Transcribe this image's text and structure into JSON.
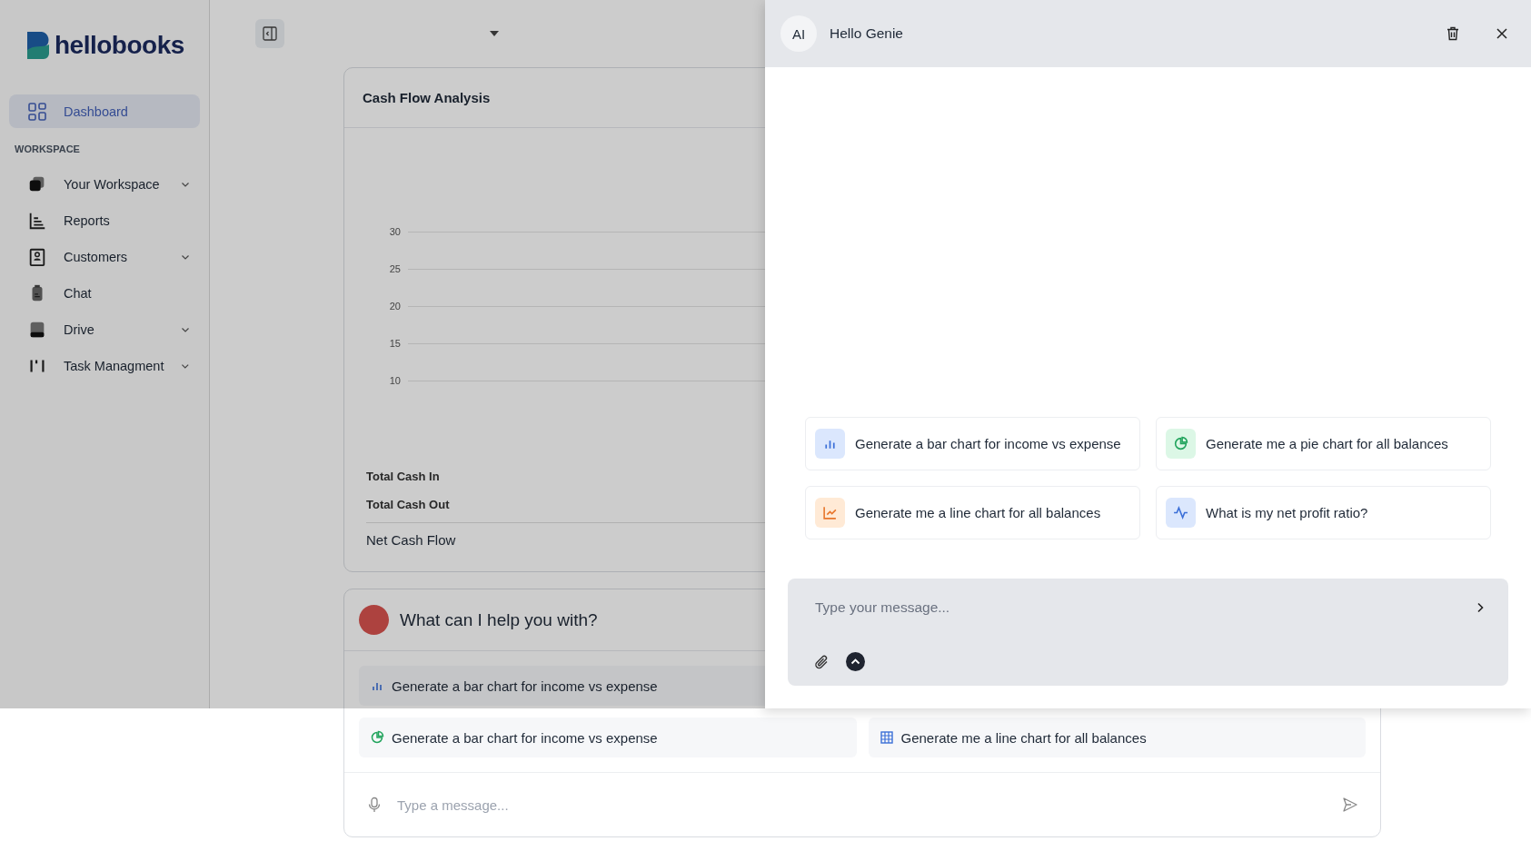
{
  "logo": {
    "text": "hellobooks"
  },
  "sidebar": {
    "top_items": [
      {
        "label": "Dashboard",
        "selected": true
      }
    ],
    "section_title": "WORKSPACE",
    "items": [
      {
        "label": "Your Workspace",
        "selected": false,
        "has_submenu": true
      },
      {
        "label": "Reports",
        "selected": false,
        "has_submenu": false
      },
      {
        "label": "Customers",
        "selected": false,
        "has_submenu": true
      },
      {
        "label": "Chat",
        "selected": false,
        "has_submenu": false
      },
      {
        "label": "Drive",
        "selected": false,
        "has_submenu": true
      },
      {
        "label": "Task Managment",
        "selected": false,
        "has_submenu": true
      }
    ]
  },
  "cash_flow_card": {
    "title": "Cash Flow Analysis",
    "y_axis_labels": [
      "30",
      "25",
      "20",
      "15",
      "10"
    ],
    "totals": [
      "Total Cash In",
      "Total Cash Out"
    ],
    "net_label": "Net Cash Flow"
  },
  "assistant_card": {
    "title": "What can I help you with?",
    "suggestion_rows": [
      [
        {
          "text": "Generate a bar chart for income vs expense",
          "kind": "bar"
        }
      ],
      [
        {
          "text": "Generate a bar chart for income vs expense",
          "kind": "pie"
        },
        {
          "text": "Generate me a line chart for all balances",
          "kind": "table"
        }
      ]
    ],
    "input": {
      "placeholder": "Type a message..."
    }
  },
  "chat_panel": {
    "avatar": "AI",
    "title": "Hello Genie",
    "suggestions": [
      {
        "text": "Generate a bar chart for income vs expense",
        "kind": "bar"
      },
      {
        "text": "Generate me a pie chart for all balances",
        "kind": "pie"
      },
      {
        "text": "Generate me a line chart for all balances",
        "kind": "line"
      },
      {
        "text": "What is my net profit ratio?",
        "kind": "pulse"
      }
    ],
    "input": {
      "placeholder": "Type your message..."
    }
  }
}
